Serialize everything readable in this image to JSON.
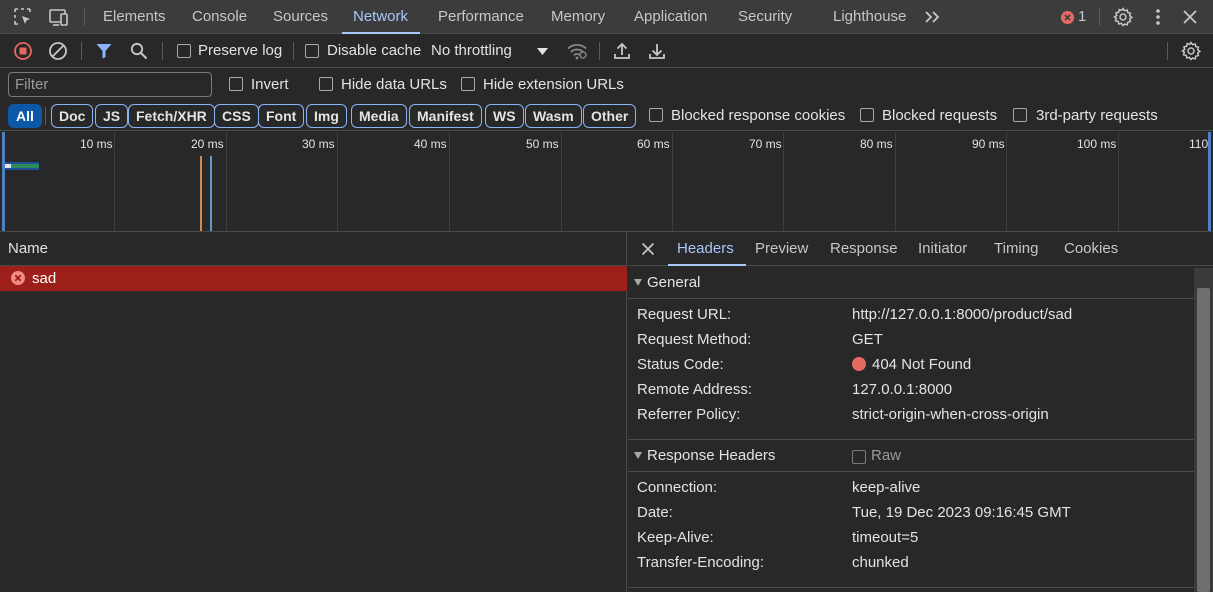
{
  "tabs": [
    {
      "label": "Elements"
    },
    {
      "label": "Console"
    },
    {
      "label": "Sources"
    },
    {
      "label": "Network"
    },
    {
      "label": "Performance"
    },
    {
      "label": "Memory"
    },
    {
      "label": "Application"
    },
    {
      "label": "Security"
    },
    {
      "label": "Lighthouse"
    }
  ],
  "error_count": "1",
  "toolbar": {
    "preserve_log": "Preserve log",
    "disable_cache": "Disable cache",
    "throttling": "No throttling"
  },
  "filterbar": {
    "placeholder": "Filter",
    "invert": "Invert",
    "hide_data_urls": "Hide data URLs",
    "hide_extension_urls": "Hide extension URLs"
  },
  "types": [
    "All",
    "Doc",
    "JS",
    "Fetch/XHR",
    "CSS",
    "Font",
    "Img",
    "Media",
    "Manifest",
    "WS",
    "Wasm",
    "Other"
  ],
  "type_checkboxes": {
    "blocked_cookies": "Blocked response cookies",
    "blocked_requests": "Blocked requests",
    "third_party": "3rd-party requests"
  },
  "overview": {
    "ticks": [
      "10 ms",
      "20 ms",
      "30 ms",
      "40 ms",
      "50 ms",
      "60 ms",
      "70 ms",
      "80 ms",
      "90 ms",
      "100 ms",
      "110"
    ]
  },
  "requests": {
    "column_name": "Name",
    "rows": [
      {
        "name": "sad",
        "status": "error"
      }
    ]
  },
  "detail": {
    "tabs": [
      "Headers",
      "Preview",
      "Response",
      "Initiator",
      "Timing",
      "Cookies"
    ],
    "general": {
      "title": "General",
      "rows": [
        {
          "key": "Request URL:",
          "value": "http://127.0.0.1:8000/product/sad"
        },
        {
          "key": "Request Method:",
          "value": "GET"
        },
        {
          "key": "Status Code:",
          "value": "404 Not Found"
        },
        {
          "key": "Remote Address:",
          "value": "127.0.0.1:8000"
        },
        {
          "key": "Referrer Policy:",
          "value": "strict-origin-when-cross-origin"
        }
      ]
    },
    "response_headers": {
      "title": "Response Headers",
      "raw_label": "Raw",
      "rows": [
        {
          "key": "Connection:",
          "value": "keep-alive"
        },
        {
          "key": "Date:",
          "value": "Tue, 19 Dec 2023 09:16:45 GMT"
        },
        {
          "key": "Keep-Alive:",
          "value": "timeout=5"
        },
        {
          "key": "Transfer-Encoding:",
          "value": "chunked"
        }
      ]
    }
  },
  "colors": {
    "accent": "#a8c7fa",
    "error_row": "#9c1f1a",
    "status_dot": "#e46962",
    "error_badge": "#e46962"
  }
}
